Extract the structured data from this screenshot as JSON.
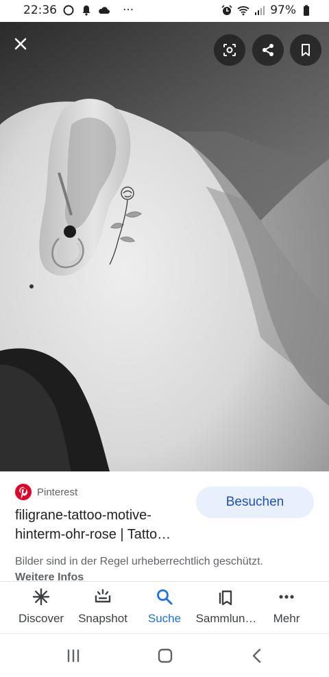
{
  "status_bar": {
    "time": "22:36",
    "battery": "97%",
    "more_dots": "···",
    "icons_left": [
      "circle-icon",
      "bell-icon",
      "cloud-icon"
    ],
    "icons_right": [
      "alarm-icon",
      "wifi-icon",
      "signal-icon",
      "battery-icon"
    ]
  },
  "viewer": {
    "buttons": [
      "close-icon",
      "lens-icon",
      "share-icon",
      "bookmark-icon"
    ]
  },
  "result": {
    "source": "Pinterest",
    "title": "filigrane-tattoo-motive-hinterm-ohr-rose | Tatto…",
    "visit_label": "Besuchen",
    "copyright_text": "Bilder sind in der Regel urheberrechtlich geschützt.",
    "more_info": "Weitere Infos",
    "accent_color": "#1a73e8",
    "pinterest_color": "#e60023"
  },
  "bottom_nav": {
    "items": [
      {
        "label": "Discover",
        "icon": "asterisk-icon"
      },
      {
        "label": "Snapshot",
        "icon": "snapshot-icon"
      },
      {
        "label": "Suche",
        "icon": "search-icon",
        "active": true
      },
      {
        "label": "Sammlun…",
        "icon": "collections-icon"
      },
      {
        "label": "Mehr",
        "icon": "more-icon"
      }
    ]
  },
  "system_nav": {
    "buttons": [
      "recents-icon",
      "home-icon",
      "back-icon"
    ]
  }
}
